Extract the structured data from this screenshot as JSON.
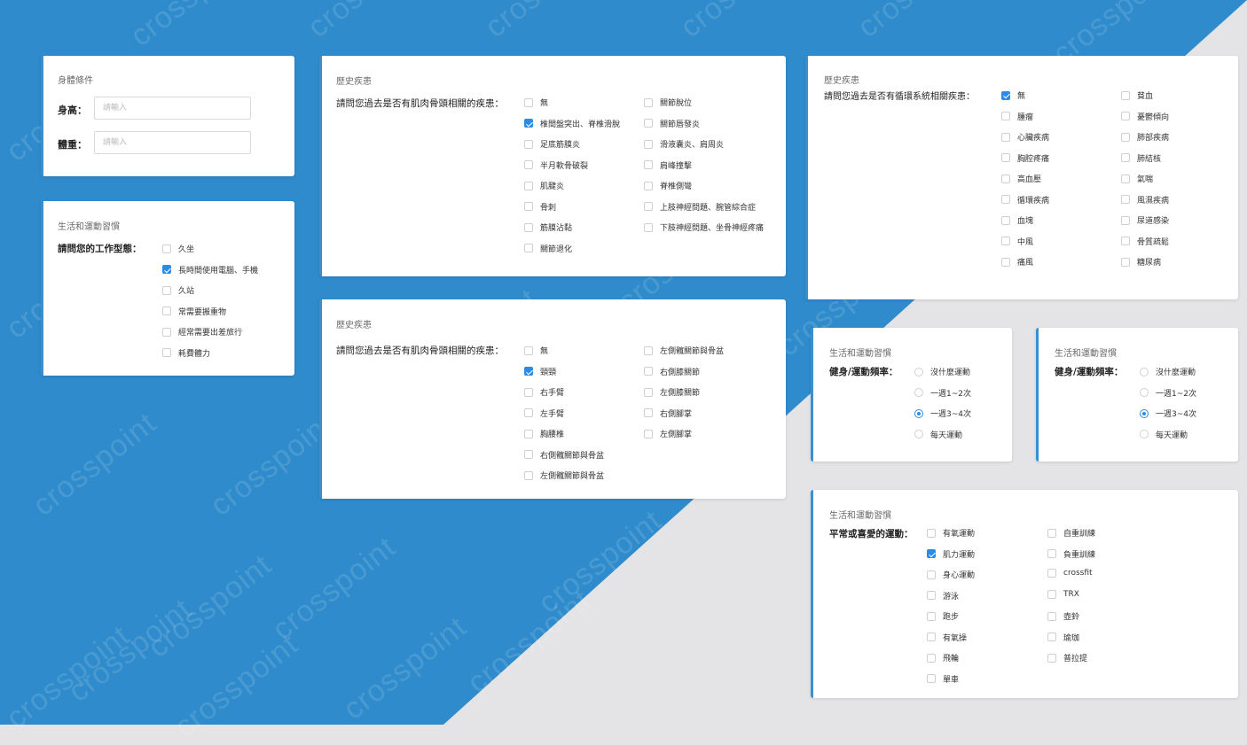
{
  "watermark": "crosspoint",
  "colors": {
    "brand_blue": "#2f8bcb",
    "accent": "#2b8be6",
    "page_gray": "#e4e4e6"
  },
  "body_conditions": {
    "title": "身體條件",
    "height_label": "身高：",
    "height_placeholder": "請輸入",
    "weight_label": "體重：",
    "weight_placeholder": "請輸入"
  },
  "work_habits": {
    "title": "生活和運動習慣",
    "question": "請問您的工作型態：",
    "options": [
      {
        "label": "久坐",
        "checked": false
      },
      {
        "label": "長時間使用電腦、手機",
        "checked": true
      },
      {
        "label": "久站",
        "checked": false
      },
      {
        "label": "常需要搬重物",
        "checked": false
      },
      {
        "label": "經常需要出差旅行",
        "checked": false
      },
      {
        "label": "耗費體力",
        "checked": false
      }
    ]
  },
  "history_musculo": {
    "title": "歷史疾患",
    "question": "請問您過去是否有肌肉骨頭相關的疾患：",
    "col1": [
      {
        "label": "無",
        "checked": false
      },
      {
        "label": "椎間盤突出、脊椎滑脫",
        "checked": true
      },
      {
        "label": "足底筋膜炎",
        "checked": false
      },
      {
        "label": "半月軟骨破裂",
        "checked": false
      },
      {
        "label": "肌腱炎",
        "checked": false
      },
      {
        "label": "骨刺",
        "checked": false
      },
      {
        "label": "筋膜沾黏",
        "checked": false
      },
      {
        "label": "關節退化",
        "checked": false
      }
    ],
    "col2": [
      {
        "label": "關節脫位",
        "checked": false
      },
      {
        "label": "關節唇發炎",
        "checked": false
      },
      {
        "label": "滑液囊炎、肩周炎",
        "checked": false
      },
      {
        "label": "肩峰撞擊",
        "checked": false
      },
      {
        "label": "脊椎側彎",
        "checked": false
      },
      {
        "label": "上肢神經問題、腕管綜合症",
        "checked": false
      },
      {
        "label": "下肢神經問題、坐骨神經疼痛",
        "checked": false
      }
    ]
  },
  "history_location": {
    "title": "歷史疾患",
    "question": "請問您過去是否有肌肉骨頭相關的疾患：",
    "col1": [
      {
        "label": "無",
        "checked": false
      },
      {
        "label": "頸頸",
        "checked": true
      },
      {
        "label": "右手臂",
        "checked": false
      },
      {
        "label": "左手臂",
        "checked": false
      },
      {
        "label": "胸腰椎",
        "checked": false
      },
      {
        "label": "右側髖關節與骨盆",
        "checked": false
      },
      {
        "label": "左側髖關節與骨盆",
        "checked": false
      }
    ],
    "col2": [
      {
        "label": "左側髖關節與骨盆",
        "checked": false
      },
      {
        "label": "右側膝關節",
        "checked": false
      },
      {
        "label": "左側膝關節",
        "checked": false
      },
      {
        "label": "右側腳掌",
        "checked": false
      },
      {
        "label": "左側腳掌",
        "checked": false
      }
    ]
  },
  "history_circulatory": {
    "title": "歷史疾患",
    "question": "請問您過去是否有循環系統相關疾患：",
    "col1": [
      {
        "label": "無",
        "checked": true
      },
      {
        "label": "腫瘤",
        "checked": false
      },
      {
        "label": "心臟疾病",
        "checked": false
      },
      {
        "label": "胸腔疼痛",
        "checked": false
      },
      {
        "label": "高血壓",
        "checked": false
      },
      {
        "label": "循環疾病",
        "checked": false
      },
      {
        "label": "血塊",
        "checked": false
      },
      {
        "label": "中風",
        "checked": false
      },
      {
        "label": "痛風",
        "checked": false
      }
    ],
    "col2": [
      {
        "label": "貧血",
        "checked": false
      },
      {
        "label": "憂鬱傾向",
        "checked": false
      },
      {
        "label": "肺部疾病",
        "checked": false
      },
      {
        "label": "肺結核",
        "checked": false
      },
      {
        "label": "氣喘",
        "checked": false
      },
      {
        "label": "風濕疾病",
        "checked": false
      },
      {
        "label": "尿道感染",
        "checked": false
      },
      {
        "label": "骨質疏鬆",
        "checked": false
      },
      {
        "label": "糖尿病",
        "checked": false
      }
    ]
  },
  "exercise_freq_a": {
    "title": "生活和運動習慣",
    "question": "健身/運動頻率：",
    "options": [
      {
        "label": "沒什麼運動",
        "selected": false
      },
      {
        "label": "一週1~2次",
        "selected": false
      },
      {
        "label": "一週3~4次",
        "selected": true
      },
      {
        "label": "每天運動",
        "selected": false
      }
    ]
  },
  "exercise_freq_b": {
    "title": "生活和運動習慣",
    "question": "健身/運動頻率：",
    "options": [
      {
        "label": "沒什麼運動",
        "selected": false
      },
      {
        "label": "一週1~2次",
        "selected": false
      },
      {
        "label": "一週3~4次",
        "selected": true
      },
      {
        "label": "每天運動",
        "selected": false
      }
    ]
  },
  "favorite_sports": {
    "title": "生活和運動習慣",
    "question": "平常或喜愛的運動：",
    "col1": [
      {
        "label": "有氧運動",
        "checked": false
      },
      {
        "label": "肌力運動",
        "checked": true
      },
      {
        "label": "身心運動",
        "checked": false
      },
      {
        "label": "游泳",
        "checked": false
      },
      {
        "label": "跑步",
        "checked": false
      },
      {
        "label": "有氧操",
        "checked": false
      },
      {
        "label": "飛輪",
        "checked": false
      },
      {
        "label": "單車",
        "checked": false
      }
    ],
    "col2": [
      {
        "label": "自重訓練",
        "checked": false
      },
      {
        "label": "負重訓練",
        "checked": false
      },
      {
        "label": "crossfit",
        "checked": false
      },
      {
        "label": "TRX",
        "checked": false
      },
      {
        "label": "壺鈴",
        "checked": false
      },
      {
        "label": "瑜珈",
        "checked": false
      },
      {
        "label": "普拉提",
        "checked": false
      }
    ]
  }
}
